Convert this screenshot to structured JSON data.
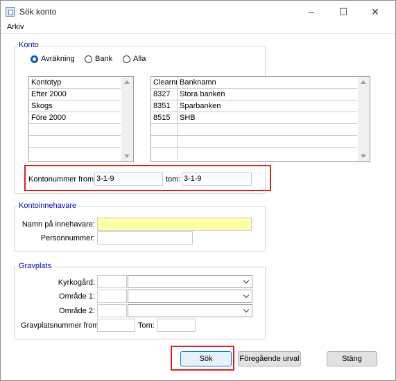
{
  "window": {
    "title": "Sök konto",
    "controls": [
      "–",
      "☐",
      "✕"
    ],
    "control_icons": [
      "minimize-icon",
      "maximize-icon",
      "close-icon"
    ]
  },
  "menu": {
    "items": [
      "Arkiv"
    ]
  },
  "konto": {
    "legend": "Konto",
    "radios": [
      {
        "label": "Avräkning",
        "checked": true
      },
      {
        "label": "Bank",
        "checked": false
      },
      {
        "label": "Alla",
        "checked": false
      }
    ],
    "kontotyp_list": [
      "Kontotyp",
      "Efter 2000",
      "Skogs",
      "Före 2000",
      "",
      "",
      ""
    ],
    "bank_list": [
      [
        "Clearnr",
        "Banknamn"
      ],
      [
        "8327",
        "Stora banken"
      ],
      [
        "8351",
        "Sparbanken"
      ],
      [
        "8515",
        "SHB"
      ],
      [
        "",
        ""
      ],
      [
        "",
        ""
      ],
      [
        "",
        ""
      ]
    ],
    "from_label": "Kontonummer from:",
    "from_value": "3-1-9",
    "tom_label": "tom:",
    "tom_value": "3-1-9"
  },
  "kontoinnehavare": {
    "legend": "Kontoinnehavare",
    "namn_label": "Namn på innehavare:",
    "namn_value": "",
    "personnr_label": "Personnummer:",
    "personnr_value": ""
  },
  "gravplats": {
    "legend": "Gravplats",
    "kyrkogard_label": "Kyrkogård:",
    "omrade1_label": "Område 1:",
    "omrade2_label": "Område 2:",
    "gpnr_from_label": "Gravplatsnummer from:",
    "gpnr_tom_label": "Tom:"
  },
  "buttons": {
    "sok": "Sök",
    "foregaende": "Föregående urval",
    "stang": "Stäng"
  },
  "colors": {
    "highlight_red": "#e02020",
    "legend_blue": "#0000cc",
    "required_yellow": "#ffffa6"
  }
}
